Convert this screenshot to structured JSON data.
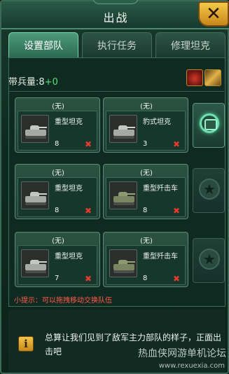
{
  "window": {
    "title": "出战"
  },
  "tabs": [
    {
      "label": "设置部队",
      "active": true
    },
    {
      "label": "执行任务",
      "active": false
    },
    {
      "label": "修理坦克",
      "active": false
    }
  ],
  "troops": {
    "label": "带兵量:",
    "base": "8",
    "bonus": "+0"
  },
  "slots": [
    {
      "header": "(无)",
      "name": "重型坦克",
      "count": "8",
      "remove": "✖"
    },
    {
      "header": "(无)",
      "name": "豹式坦克",
      "count": "3",
      "remove": "✖"
    },
    {
      "header": "(无)",
      "name": "重型坦克",
      "count": "8",
      "remove": "✖"
    },
    {
      "header": "(无)",
      "name": "重型歼击车",
      "count": "8",
      "remove": "✖"
    },
    {
      "header": "(无)",
      "name": "重型坦克",
      "count": "7",
      "remove": "✖"
    },
    {
      "header": "(无)",
      "name": "重型歼击车",
      "count": "8",
      "remove": "✖"
    }
  ],
  "hint": "小提示：可以拖拽移动交换队伍",
  "info": {
    "icon": "i",
    "text": "总算让我们见到了敌军主力部队的样子，正面出击吧"
  },
  "watermark": {
    "text": "热血侠网游单机论坛",
    "url": "www.rexuexia.com"
  },
  "colors": {
    "accent": "#4e9a7a",
    "hint": "#ff5b4a",
    "remove": "#e53a2e",
    "close": "#f6c94a"
  }
}
